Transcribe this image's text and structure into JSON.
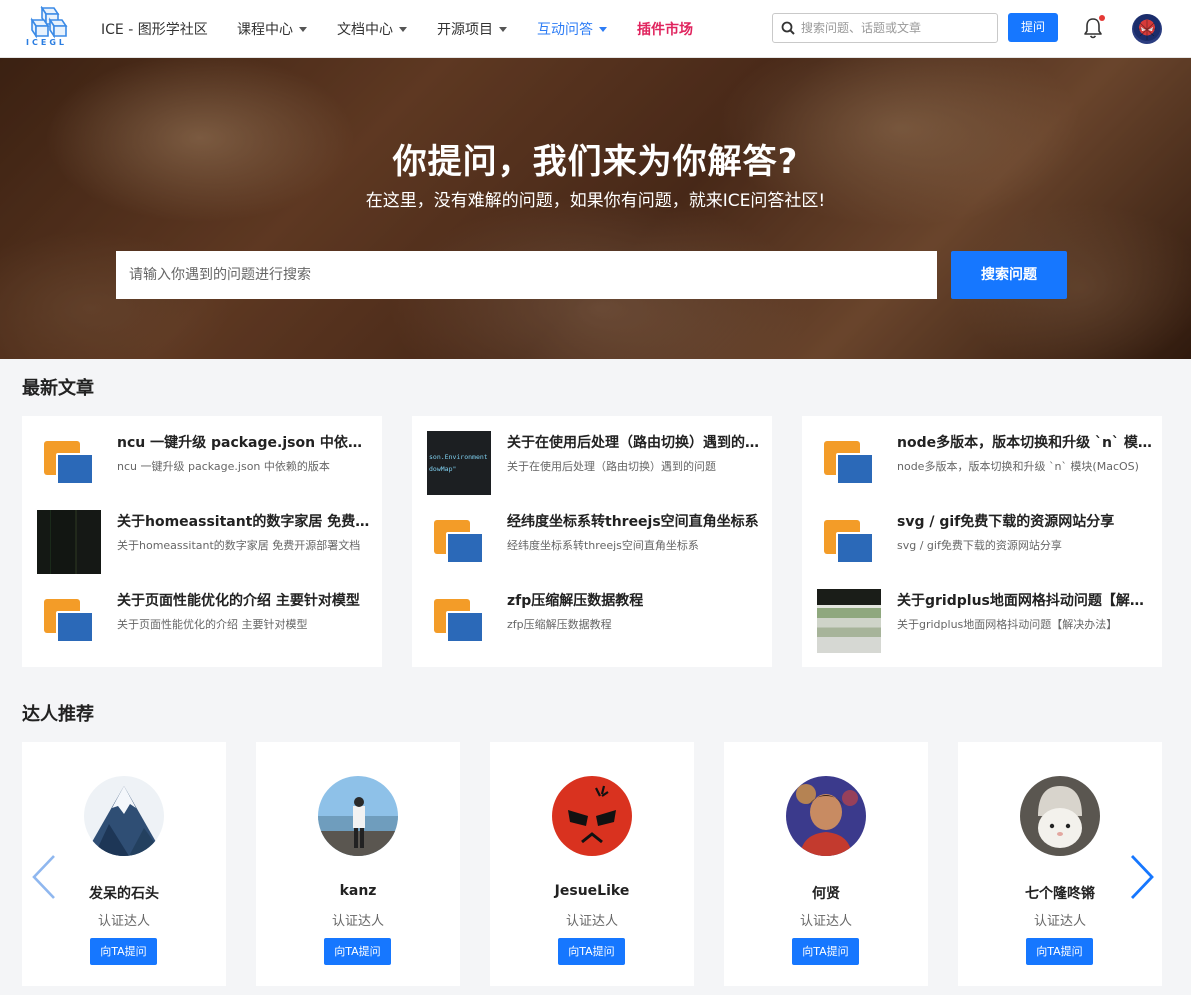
{
  "header": {
    "logo_text": "ICEGL",
    "site_name": "ICE - 图形学社区",
    "nav": [
      {
        "label": "课程中心",
        "dropdown": true
      },
      {
        "label": "文档中心",
        "dropdown": true
      },
      {
        "label": "开源项目",
        "dropdown": true
      },
      {
        "label": "互动问答",
        "dropdown": true,
        "active": true
      },
      {
        "label": "插件市场",
        "dropdown": false,
        "highlight": true
      }
    ],
    "search_placeholder": "搜索问题、话题或文章",
    "ask_label": "提问",
    "notification_dot": true
  },
  "hero": {
    "title": "你提问，我们来为你解答?",
    "subtitle": "在这里，没有难解的问题，如果你有问题，就来ICE问答社区!",
    "search_placeholder": "请输入你遇到的问题进行搜索",
    "search_button": "搜索问题"
  },
  "articles_section": {
    "title": "最新文章",
    "columns": [
      [
        {
          "title": "ncu 一键升级 package.json 中依赖的版本",
          "summary": "ncu 一键升级 package.json 中依赖的版本",
          "thumb": "folder-icon"
        },
        {
          "title": "关于homeassitant的数字家居 免费开源部署文档",
          "summary": "关于homeassitant的数字家居 免费开源部署文档",
          "thumb": "dark-screenshot"
        },
        {
          "title": "关于页面性能优化的介绍 主要针对模型",
          "summary": "关于页面性能优化的介绍 主要针对模型",
          "thumb": "folder-icon"
        }
      ],
      [
        {
          "title": "关于在使用后处理（路由切换）遇到的问题",
          "summary": "关于在使用后处理（路由切换）遇到的问题",
          "thumb": "code-screenshot",
          "code_lines": [
            "son.Environment",
            "dowMap\"",
            ""
          ]
        },
        {
          "title": "经纬度坐标系转threejs空间直角坐标系",
          "summary": "经纬度坐标系转threejs空间直角坐标系",
          "thumb": "folder-icon"
        },
        {
          "title": "zfp压缩解压数据教程",
          "summary": "zfp压缩解压数据教程",
          "thumb": "folder-icon"
        }
      ],
      [
        {
          "title": "node多版本，版本切换和升级 `n` 模块(MacOS)",
          "summary": "node多版本，版本切换和升级 `n` 模块(MacOS)",
          "thumb": "folder-icon"
        },
        {
          "title": "svg / gif免费下载的资源网站分享",
          "summary": "svg / gif免费下载的资源网站分享",
          "thumb": "folder-icon"
        },
        {
          "title": "关于gridplus地面网格抖动问题【解决办法】",
          "summary": "关于gridplus地面网格抖动问题【解决办法】",
          "thumb": "photo-screenshot"
        }
      ]
    ]
  },
  "experts_section": {
    "title": "达人推荐",
    "experts": [
      {
        "name": "发呆的石头",
        "role": "认证达人",
        "button": "向TA提问",
        "avatar": "mountain-avatar"
      },
      {
        "name": "kanz",
        "role": "认证达人",
        "button": "向TA提问",
        "avatar": "person-avatar"
      },
      {
        "name": "JesueLike",
        "role": "认证达人",
        "button": "向TA提问",
        "avatar": "angry-face-avatar"
      },
      {
        "name": "何贤",
        "role": "认证达人",
        "button": "向TA提问",
        "avatar": "boy-avatar"
      },
      {
        "name": "七个隆咚锵",
        "role": "认证达人",
        "button": "向TA提问",
        "avatar": "bunny-avatar"
      }
    ]
  },
  "colors": {
    "primary": "#1677ff",
    "active_nav": "#2e7df5",
    "hot_nav": "#e0245e",
    "page_bg": "#f4f5f7"
  }
}
